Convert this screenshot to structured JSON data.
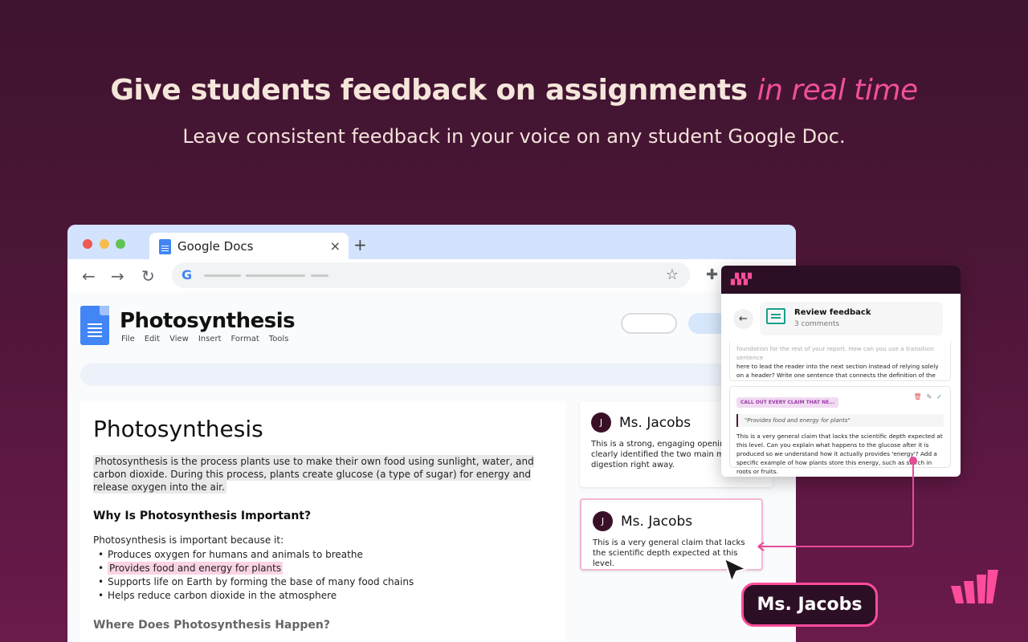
{
  "hero": {
    "title_main": "Give students feedback on assignments ",
    "title_accent": "in real time",
    "subtitle": "Leave consistent feedback in your voice on any student Google Doc."
  },
  "browser": {
    "tab_title": "Google Docs",
    "tab_close": "×",
    "new_tab": "+",
    "back": "←",
    "forward": "→",
    "reload": "↻",
    "google_logo": "G",
    "star": "☆",
    "extensions": "✚"
  },
  "doc": {
    "title": "Photosynthesis",
    "menus": [
      "File",
      "Edit",
      "View",
      "Insert",
      "Format",
      "Tools"
    ],
    "heading": "Photosynthesis",
    "intro": "Photosynthesis is the process plants use to make their own food using sunlight, water, and carbon dioxide. During this process, plants create glucose (a type of sugar) for energy and release oxygen into the air.",
    "section1_title": "Why Is Photosynthesis Important?",
    "section1_lead": "Photosynthesis is important because it:",
    "bullets": [
      "Produces oxygen for humans and animals to breathe",
      "Provides food and energy for plants",
      "Supports life on Earth by forming the base of many food chains",
      "Helps reduce carbon dioxide in the atmosphere"
    ],
    "section2_title": "Where Does Photosynthesis Happen?"
  },
  "comments": [
    {
      "avatar": "J",
      "name": "Ms. Jacobs",
      "text": "This is a strong, engaging opening. You clearly identified the two main mode… digestion right away."
    },
    {
      "avatar": "J",
      "name": "Ms. Jacobs",
      "text": "This is a very general claim that lacks the scientific depth expected at this level."
    }
  ],
  "panel": {
    "back": "←",
    "review_title": "Review feedback",
    "review_count": "3 comments",
    "card1_text_faded": "foundation for the rest of your report. How can you use a transition sentence",
    "card1_text": "here to lead the reader into the next section instead of relying solely on a header? Write one sentence that connects the definition of the process to its global importance.",
    "tag": "CALL OUT EVERY CLAIM THAT NE...",
    "quote": "\"Provides food and energy for plants\"",
    "card2_text": "This is a very general claim that lacks the scientific depth expected at this level. Can you explain what happens to the glucose after it is produced so we understand how it actually provides 'energy'? Add a specific example of how plants store this energy, such as starch in roots or fruits.",
    "action_delete": "🗑",
    "action_edit": "✎",
    "action_accept": "✓"
  },
  "cursor_label": "Ms. Jacobs",
  "colors": {
    "accent_pink": "#f0509a",
    "dark_plum": "#2c0f24",
    "teal": "#1aa08b"
  }
}
